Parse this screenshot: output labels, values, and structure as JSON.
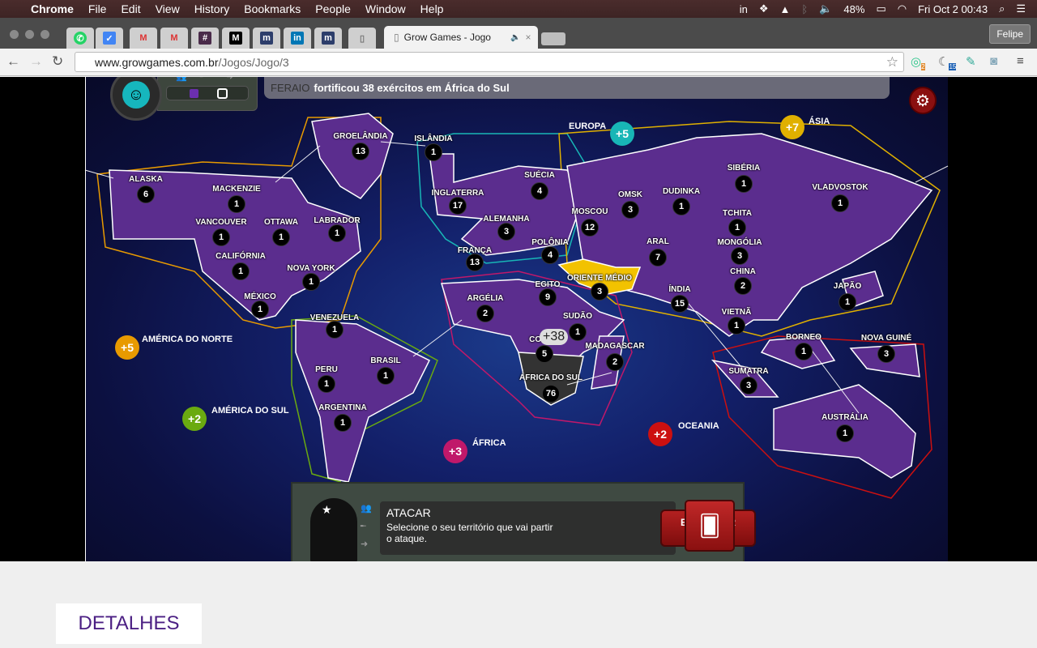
{
  "menubar": {
    "app": "Chrome",
    "items": [
      "File",
      "Edit",
      "View",
      "History",
      "Bookmarks",
      "People",
      "Window",
      "Help"
    ],
    "battery": "48%",
    "clock": "Fri Oct 2  00:43"
  },
  "browser": {
    "active_tab": "Grow Games - Jogo",
    "user": "Felipe",
    "url_host": "www.growgames.com.br",
    "url_path": "/Jogos/Jogo/3",
    "ext_badges": [
      "2",
      "15"
    ]
  },
  "game": {
    "notification": {
      "player": "FERAIO",
      "message": "fortificou 38 exércitos em África do Sul"
    },
    "overlay_gain": "+38",
    "colors": {
      "player": "#5b2d8e",
      "enemy": "#333333",
      "selected": "#f2c200"
    },
    "territories": [
      {
        "name": "ALASKA",
        "armies": "6"
      },
      {
        "name": "MACKENZIE",
        "armies": "1"
      },
      {
        "name": "GROELÂNDIA",
        "armies": "13"
      },
      {
        "name": "ISLÂNDIA",
        "armies": "1"
      },
      {
        "name": "VANCOUVER",
        "armies": "1"
      },
      {
        "name": "OTTAWA",
        "armies": "1"
      },
      {
        "name": "LABRADOR",
        "armies": "1"
      },
      {
        "name": "CALIFÓRNIA",
        "armies": "1"
      },
      {
        "name": "NOVA YORK",
        "armies": "1"
      },
      {
        "name": "MÉXICO",
        "armies": "1"
      },
      {
        "name": "VENEZUELA",
        "armies": "1"
      },
      {
        "name": "BRASIL",
        "armies": "1"
      },
      {
        "name": "PERU",
        "armies": "1"
      },
      {
        "name": "ARGENTINA",
        "armies": "1"
      },
      {
        "name": "INGLATERRA",
        "armies": "17"
      },
      {
        "name": "SUÉCIA",
        "armies": "4"
      },
      {
        "name": "ALEMANHA",
        "armies": "3"
      },
      {
        "name": "FRANÇA",
        "armies": "13"
      },
      {
        "name": "POLÔNIA",
        "armies": "4"
      },
      {
        "name": "MOSCOU",
        "armies": "12"
      },
      {
        "name": "OMSK",
        "armies": "3"
      },
      {
        "name": "DUDINKA",
        "armies": "1"
      },
      {
        "name": "SIBÉRIA",
        "armies": "1"
      },
      {
        "name": "VLADVOSTOK",
        "armies": "1"
      },
      {
        "name": "TCHITA",
        "armies": "1"
      },
      {
        "name": "ARAL",
        "armies": "7"
      },
      {
        "name": "MONGÓLIA",
        "armies": "3"
      },
      {
        "name": "CHINA",
        "armies": "2"
      },
      {
        "name": "ORIENTE MÉDIO",
        "armies": "3"
      },
      {
        "name": "ÍNDIA",
        "armies": "15"
      },
      {
        "name": "JAPÃO",
        "armies": "1"
      },
      {
        "name": "VIETNÃ",
        "armies": "1"
      },
      {
        "name": "ARGÉLIA",
        "armies": "2"
      },
      {
        "name": "EGITO",
        "armies": "9"
      },
      {
        "name": "SUDÃO",
        "armies": "1"
      },
      {
        "name": "CONGO",
        "armies": "5"
      },
      {
        "name": "MADAGASCAR",
        "armies": "2"
      },
      {
        "name": "ÁFRICA DO SUL",
        "armies": "76"
      },
      {
        "name": "BORNEO",
        "armies": "1"
      },
      {
        "name": "NOVA GUINÉ",
        "armies": "3"
      },
      {
        "name": "SUMATRA",
        "armies": "3"
      },
      {
        "name": "AUSTRÁLIA",
        "armies": "1"
      }
    ],
    "continents": [
      {
        "name": "AMÉRICA DO NORTE",
        "bonus": "+5",
        "color": "#e89a00"
      },
      {
        "name": "AMÉRICA DO SUL",
        "bonus": "+2",
        "color": "#6aaa10"
      },
      {
        "name": "EUROPA",
        "bonus": "+5",
        "color": "#18b6b6"
      },
      {
        "name": "ÁSIA",
        "bonus": "+7",
        "color": "#e0b000"
      },
      {
        "name": "ÁFRICA",
        "bonus": "+3",
        "color": "#c0186a"
      },
      {
        "name": "OCEANIA",
        "bonus": "+2",
        "color": "#cc1010"
      }
    ],
    "action": {
      "title": "ATACAR",
      "description": "Selecione o seu território que vai partir o ataque.",
      "end_button": "ENCERRAR ATAQUES"
    }
  },
  "page": {
    "details_tab": "DETALHES"
  }
}
